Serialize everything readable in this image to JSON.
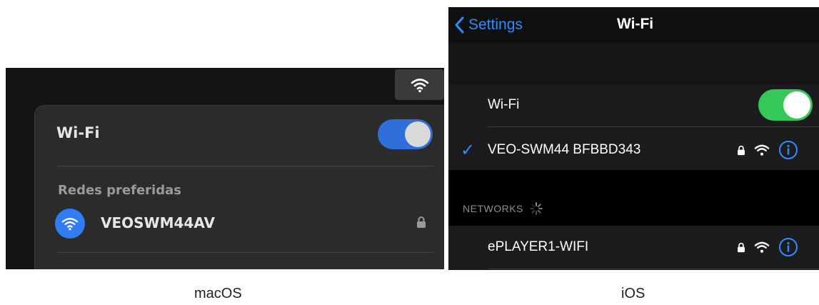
{
  "macos": {
    "wifi_title": "Wi-Fi",
    "wifi_enabled": true,
    "section_label": "Redes preferidas",
    "network_name": "VEOSWM44AV",
    "icons": [
      "wifi-icon",
      "lock-icon"
    ]
  },
  "ios": {
    "back_label": "Settings",
    "title": "Wi-Fi",
    "wifi_label": "Wi-Fi",
    "wifi_enabled": true,
    "connected_network": "VEO-SWM44 BFBBD343",
    "section_label": "NETWORKS",
    "networks": [
      "ePLAYER1-WIFI"
    ],
    "icons": [
      "chevron-left-icon",
      "checkmark-icon",
      "lock-icon",
      "wifi-icon",
      "info-icon",
      "spinner-icon"
    ],
    "accent_color": "#2f8cff",
    "toggle_color": "#34c759"
  },
  "captions": {
    "left": "macOS",
    "right": "iOS"
  }
}
